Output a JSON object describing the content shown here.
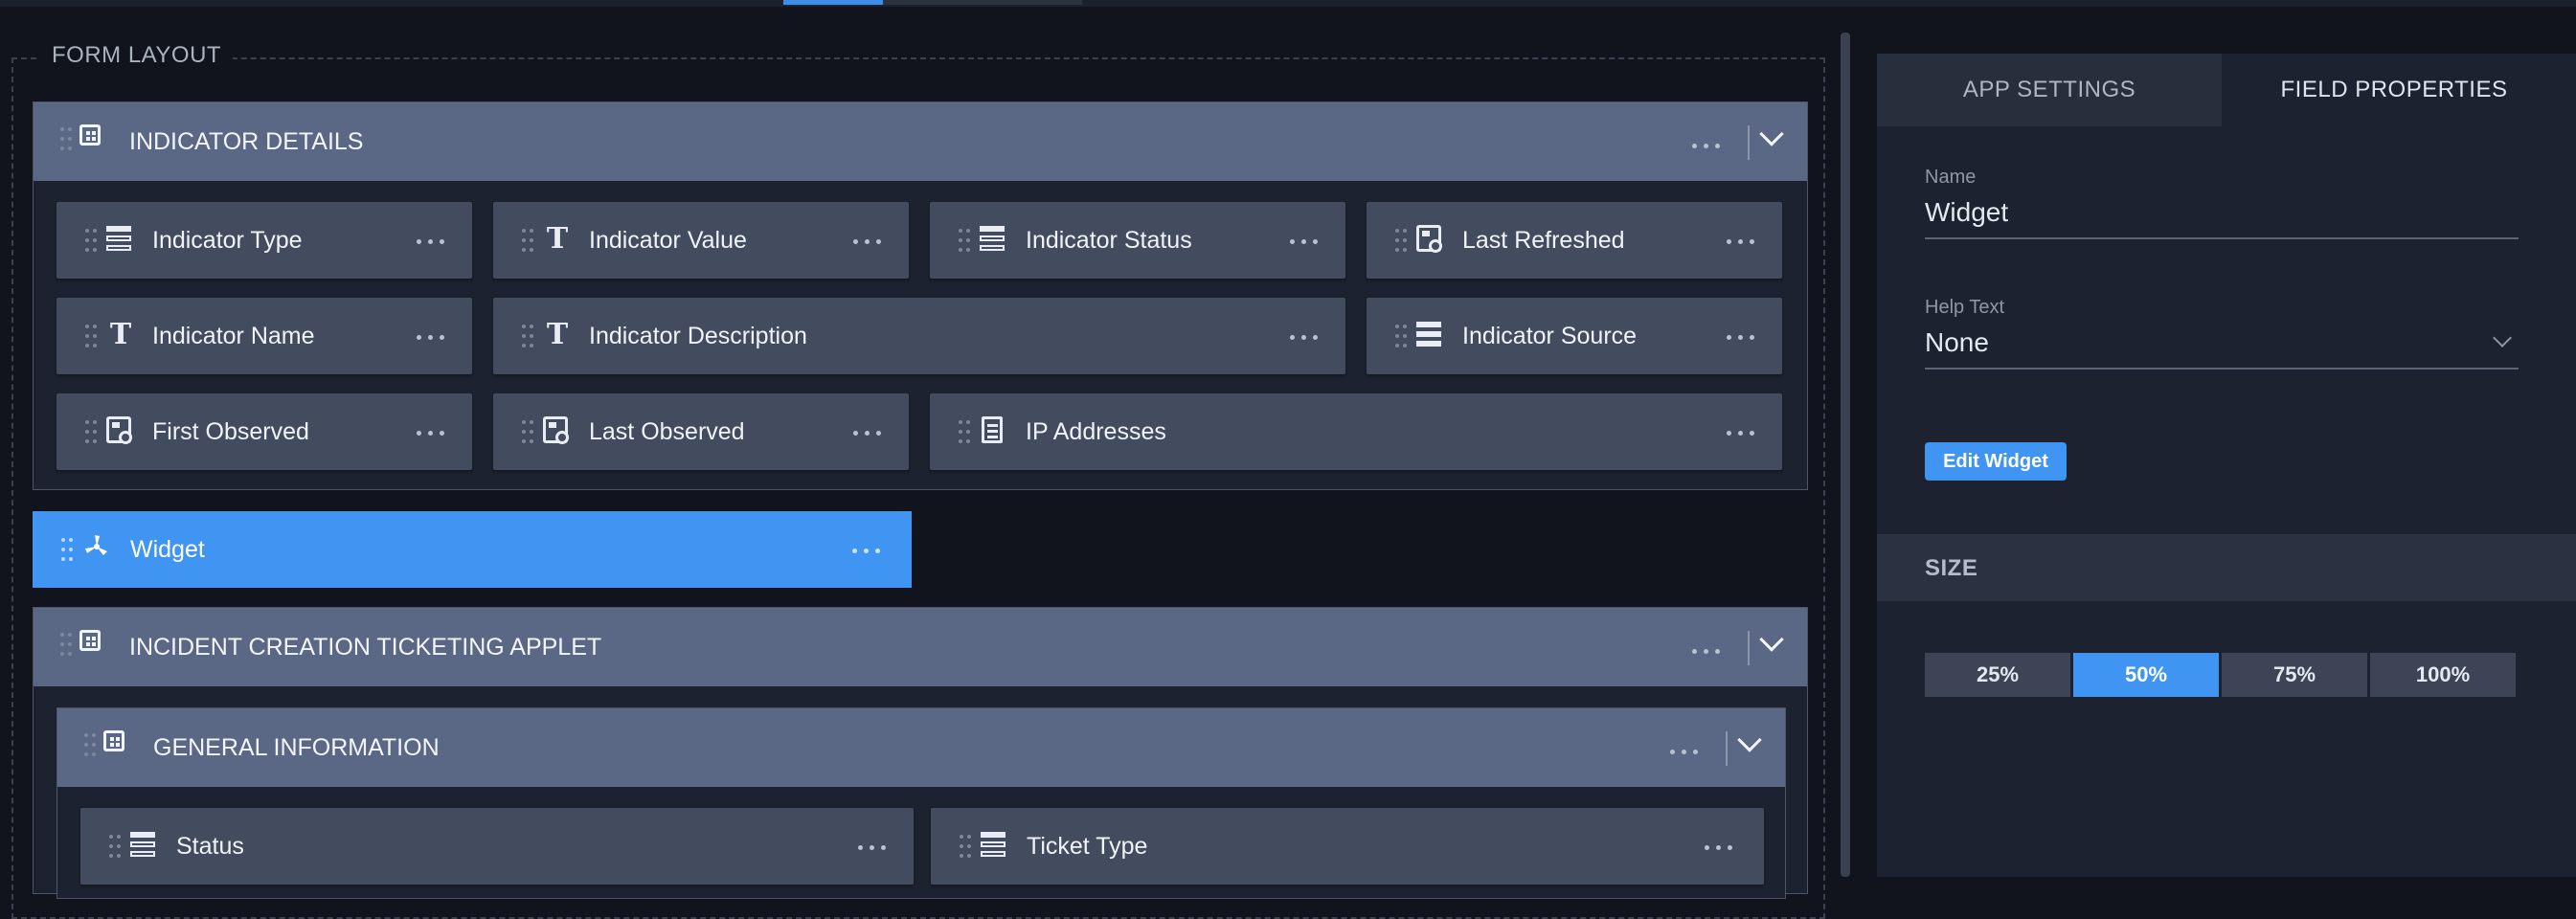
{
  "form_layout": {
    "legend": "FORM LAYOUT",
    "sections": [
      {
        "title": "INDICATOR DETAILS",
        "fields": [
          {
            "label": "Indicator Type",
            "icon": "list-icon"
          },
          {
            "label": "Indicator Value",
            "icon": "text-icon"
          },
          {
            "label": "Indicator Status",
            "icon": "list-icon"
          },
          {
            "label": "Last Refreshed",
            "icon": "date-icon"
          },
          {
            "label": "Indicator Name",
            "icon": "text-icon"
          },
          {
            "label": "Indicator Description",
            "icon": "text-icon"
          },
          {
            "label": "Indicator Source",
            "icon": "list-solid-icon"
          },
          {
            "label": "First Observed",
            "icon": "date-icon"
          },
          {
            "label": "Last Observed",
            "icon": "date-icon"
          },
          {
            "label": "IP Addresses",
            "icon": "document-icon"
          }
        ]
      },
      {
        "title": "INCIDENT CREATION TICKETING APPLET"
      }
    ],
    "widget": {
      "label": "Widget",
      "icon": "widget-fan-icon",
      "color": "#4095f2"
    },
    "subsection": {
      "title": "GENERAL INFORMATION",
      "fields": [
        {
          "label": "Status",
          "icon": "list-icon"
        },
        {
          "label": "Ticket Type",
          "icon": "list-icon"
        }
      ]
    }
  },
  "panel": {
    "tabs": [
      "APP SETTINGS",
      "FIELD PROPERTIES"
    ],
    "active_tab": "FIELD PROPERTIES",
    "name_label": "Name",
    "name_value": "Widget",
    "help_label": "Help Text",
    "help_value": "None",
    "edit_button": "Edit Widget",
    "size_label": "SIZE",
    "size_options": [
      "25%",
      "50%",
      "75%",
      "100%"
    ],
    "size_selected": "50%"
  },
  "colors": {
    "accent": "#4095f2",
    "section_header": "#5a6785",
    "field_bg": "#434b5f",
    "background": "#11141c"
  }
}
